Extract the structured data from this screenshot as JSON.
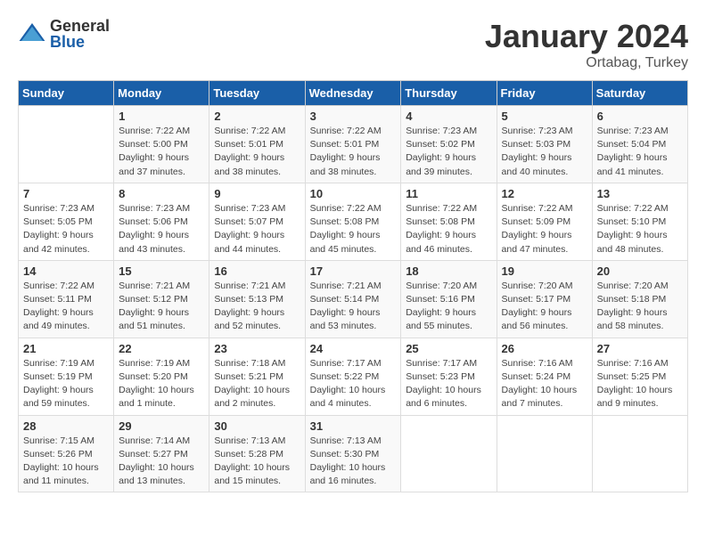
{
  "header": {
    "logo_general": "General",
    "logo_blue": "Blue",
    "month_title": "January 2024",
    "location": "Ortabag, Turkey"
  },
  "weekdays": [
    "Sunday",
    "Monday",
    "Tuesday",
    "Wednesday",
    "Thursday",
    "Friday",
    "Saturday"
  ],
  "weeks": [
    [
      {
        "day": "",
        "sunrise": "",
        "sunset": "",
        "daylight": ""
      },
      {
        "day": "1",
        "sunrise": "Sunrise: 7:22 AM",
        "sunset": "Sunset: 5:00 PM",
        "daylight": "Daylight: 9 hours and 37 minutes."
      },
      {
        "day": "2",
        "sunrise": "Sunrise: 7:22 AM",
        "sunset": "Sunset: 5:01 PM",
        "daylight": "Daylight: 9 hours and 38 minutes."
      },
      {
        "day": "3",
        "sunrise": "Sunrise: 7:22 AM",
        "sunset": "Sunset: 5:01 PM",
        "daylight": "Daylight: 9 hours and 38 minutes."
      },
      {
        "day": "4",
        "sunrise": "Sunrise: 7:23 AM",
        "sunset": "Sunset: 5:02 PM",
        "daylight": "Daylight: 9 hours and 39 minutes."
      },
      {
        "day": "5",
        "sunrise": "Sunrise: 7:23 AM",
        "sunset": "Sunset: 5:03 PM",
        "daylight": "Daylight: 9 hours and 40 minutes."
      },
      {
        "day": "6",
        "sunrise": "Sunrise: 7:23 AM",
        "sunset": "Sunset: 5:04 PM",
        "daylight": "Daylight: 9 hours and 41 minutes."
      }
    ],
    [
      {
        "day": "7",
        "sunrise": "Sunrise: 7:23 AM",
        "sunset": "Sunset: 5:05 PM",
        "daylight": "Daylight: 9 hours and 42 minutes."
      },
      {
        "day": "8",
        "sunrise": "Sunrise: 7:23 AM",
        "sunset": "Sunset: 5:06 PM",
        "daylight": "Daylight: 9 hours and 43 minutes."
      },
      {
        "day": "9",
        "sunrise": "Sunrise: 7:23 AM",
        "sunset": "Sunset: 5:07 PM",
        "daylight": "Daylight: 9 hours and 44 minutes."
      },
      {
        "day": "10",
        "sunrise": "Sunrise: 7:22 AM",
        "sunset": "Sunset: 5:08 PM",
        "daylight": "Daylight: 9 hours and 45 minutes."
      },
      {
        "day": "11",
        "sunrise": "Sunrise: 7:22 AM",
        "sunset": "Sunset: 5:08 PM",
        "daylight": "Daylight: 9 hours and 46 minutes."
      },
      {
        "day": "12",
        "sunrise": "Sunrise: 7:22 AM",
        "sunset": "Sunset: 5:09 PM",
        "daylight": "Daylight: 9 hours and 47 minutes."
      },
      {
        "day": "13",
        "sunrise": "Sunrise: 7:22 AM",
        "sunset": "Sunset: 5:10 PM",
        "daylight": "Daylight: 9 hours and 48 minutes."
      }
    ],
    [
      {
        "day": "14",
        "sunrise": "Sunrise: 7:22 AM",
        "sunset": "Sunset: 5:11 PM",
        "daylight": "Daylight: 9 hours and 49 minutes."
      },
      {
        "day": "15",
        "sunrise": "Sunrise: 7:21 AM",
        "sunset": "Sunset: 5:12 PM",
        "daylight": "Daylight: 9 hours and 51 minutes."
      },
      {
        "day": "16",
        "sunrise": "Sunrise: 7:21 AM",
        "sunset": "Sunset: 5:13 PM",
        "daylight": "Daylight: 9 hours and 52 minutes."
      },
      {
        "day": "17",
        "sunrise": "Sunrise: 7:21 AM",
        "sunset": "Sunset: 5:14 PM",
        "daylight": "Daylight: 9 hours and 53 minutes."
      },
      {
        "day": "18",
        "sunrise": "Sunrise: 7:20 AM",
        "sunset": "Sunset: 5:16 PM",
        "daylight": "Daylight: 9 hours and 55 minutes."
      },
      {
        "day": "19",
        "sunrise": "Sunrise: 7:20 AM",
        "sunset": "Sunset: 5:17 PM",
        "daylight": "Daylight: 9 hours and 56 minutes."
      },
      {
        "day": "20",
        "sunrise": "Sunrise: 7:20 AM",
        "sunset": "Sunset: 5:18 PM",
        "daylight": "Daylight: 9 hours and 58 minutes."
      }
    ],
    [
      {
        "day": "21",
        "sunrise": "Sunrise: 7:19 AM",
        "sunset": "Sunset: 5:19 PM",
        "daylight": "Daylight: 9 hours and 59 minutes."
      },
      {
        "day": "22",
        "sunrise": "Sunrise: 7:19 AM",
        "sunset": "Sunset: 5:20 PM",
        "daylight": "Daylight: 10 hours and 1 minute."
      },
      {
        "day": "23",
        "sunrise": "Sunrise: 7:18 AM",
        "sunset": "Sunset: 5:21 PM",
        "daylight": "Daylight: 10 hours and 2 minutes."
      },
      {
        "day": "24",
        "sunrise": "Sunrise: 7:17 AM",
        "sunset": "Sunset: 5:22 PM",
        "daylight": "Daylight: 10 hours and 4 minutes."
      },
      {
        "day": "25",
        "sunrise": "Sunrise: 7:17 AM",
        "sunset": "Sunset: 5:23 PM",
        "daylight": "Daylight: 10 hours and 6 minutes."
      },
      {
        "day": "26",
        "sunrise": "Sunrise: 7:16 AM",
        "sunset": "Sunset: 5:24 PM",
        "daylight": "Daylight: 10 hours and 7 minutes."
      },
      {
        "day": "27",
        "sunrise": "Sunrise: 7:16 AM",
        "sunset": "Sunset: 5:25 PM",
        "daylight": "Daylight: 10 hours and 9 minutes."
      }
    ],
    [
      {
        "day": "28",
        "sunrise": "Sunrise: 7:15 AM",
        "sunset": "Sunset: 5:26 PM",
        "daylight": "Daylight: 10 hours and 11 minutes."
      },
      {
        "day": "29",
        "sunrise": "Sunrise: 7:14 AM",
        "sunset": "Sunset: 5:27 PM",
        "daylight": "Daylight: 10 hours and 13 minutes."
      },
      {
        "day": "30",
        "sunrise": "Sunrise: 7:13 AM",
        "sunset": "Sunset: 5:28 PM",
        "daylight": "Daylight: 10 hours and 15 minutes."
      },
      {
        "day": "31",
        "sunrise": "Sunrise: 7:13 AM",
        "sunset": "Sunset: 5:30 PM",
        "daylight": "Daylight: 10 hours and 16 minutes."
      },
      {
        "day": "",
        "sunrise": "",
        "sunset": "",
        "daylight": ""
      },
      {
        "day": "",
        "sunrise": "",
        "sunset": "",
        "daylight": ""
      },
      {
        "day": "",
        "sunrise": "",
        "sunset": "",
        "daylight": ""
      }
    ]
  ]
}
